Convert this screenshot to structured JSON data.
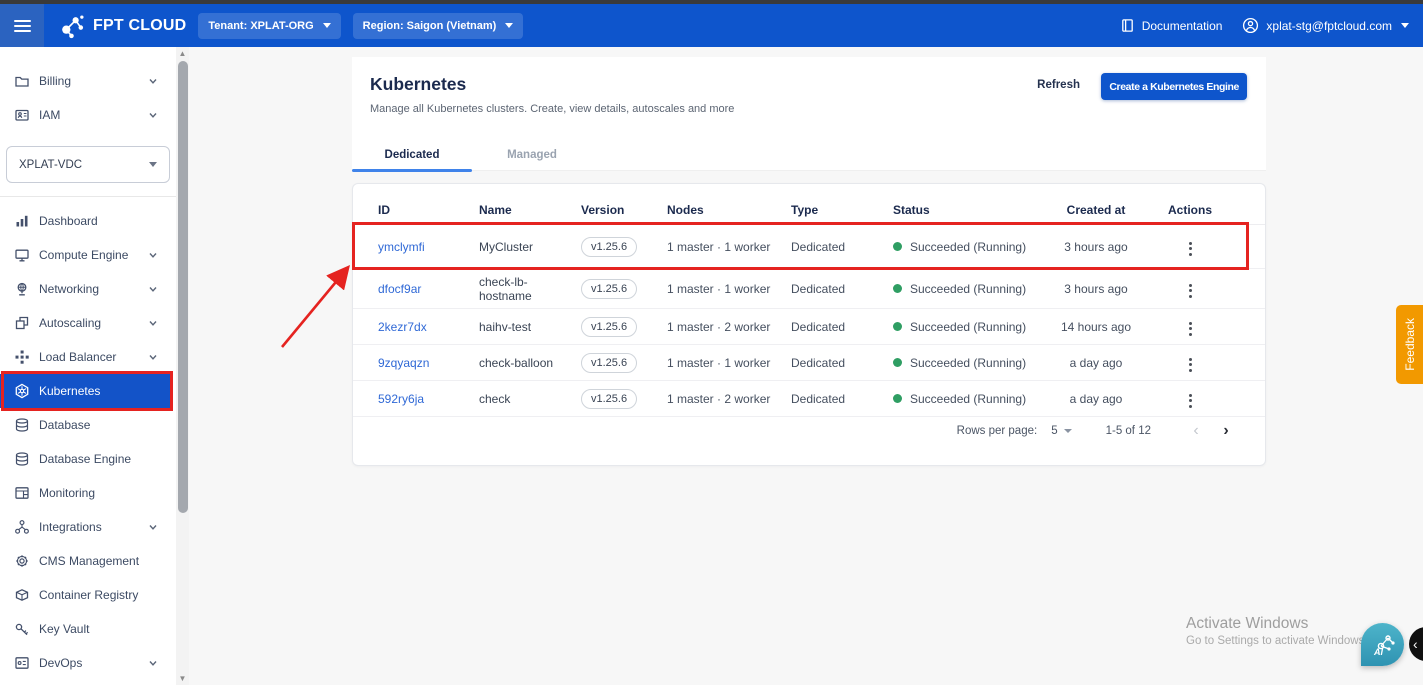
{
  "topbar": {
    "logo_text": "FPT CLOUD",
    "tenant": "Tenant: XPLAT-ORG",
    "region": "Region: Saigon (Vietnam)",
    "documentation": "Documentation",
    "account": "xplat-stg@fptcloud.com"
  },
  "sidebar": {
    "top_items": [
      {
        "label": "Billing",
        "icon": "billing",
        "chevron": true
      },
      {
        "label": "IAM",
        "icon": "iam",
        "chevron": true
      }
    ],
    "vdc_selector": "XPLAT-VDC",
    "items": [
      {
        "label": "Dashboard",
        "icon": "dashboard"
      },
      {
        "label": "Compute Engine",
        "icon": "compute-engine",
        "chevron": true
      },
      {
        "label": "Networking",
        "icon": "networking",
        "chevron": true
      },
      {
        "label": "Autoscaling",
        "icon": "autoscaling",
        "chevron": true
      },
      {
        "label": "Load Balancer",
        "icon": "load-balancer",
        "chevron": true
      },
      {
        "label": "Kubernetes",
        "icon": "kubernetes",
        "selected": true
      },
      {
        "label": "Database",
        "icon": "database"
      },
      {
        "label": "Database Engine",
        "icon": "database-engine"
      },
      {
        "label": "Monitoring",
        "icon": "monitoring"
      },
      {
        "label": "Integrations",
        "icon": "integrations",
        "chevron": true
      },
      {
        "label": "CMS Management",
        "icon": "cms-management"
      },
      {
        "label": "Container Registry",
        "icon": "container-registry"
      },
      {
        "label": "Key Vault",
        "icon": "key-vault"
      },
      {
        "label": "DevOps",
        "icon": "devops",
        "chevron": true
      }
    ]
  },
  "main": {
    "title": "Kubernetes",
    "subtitle": "Manage all Kubernetes clusters. Create, view details, autoscales and more",
    "refresh_label": "Refresh",
    "create_label": "Create a Kubernetes Engine",
    "tabs": {
      "active": "Dedicated",
      "inactive": "Managed"
    },
    "table": {
      "columns": [
        "ID",
        "Name",
        "Version",
        "Nodes",
        "Type",
        "Status",
        "Created at",
        "Actions"
      ],
      "rows": [
        {
          "id": "ymclymfi",
          "name": "MyCluster",
          "version": "v1.25.6",
          "nodes": "1 master · 1 worker",
          "type": "Dedicated",
          "status": "Succeeded (Running)",
          "created": "3 hours ago",
          "highlighted": true
        },
        {
          "id": "dfocf9ar",
          "name": "check-lb-hostname",
          "version": "v1.25.6",
          "nodes": "1 master · 1 worker",
          "type": "Dedicated",
          "status": "Succeeded (Running)",
          "created": "3 hours ago"
        },
        {
          "id": "2kezr7dx",
          "name": "haihv-test",
          "version": "v1.25.6",
          "nodes": "1 master · 2 worker",
          "type": "Dedicated",
          "status": "Succeeded (Running)",
          "created": "14 hours ago"
        },
        {
          "id": "9zqyaqzn",
          "name": "check-balloon",
          "version": "v1.25.6",
          "nodes": "1 master · 1 worker",
          "type": "Dedicated",
          "status": "Succeeded (Running)",
          "created": "a day ago"
        },
        {
          "id": "592ry6ja",
          "name": "check",
          "version": "v1.25.6",
          "nodes": "1 master · 2 worker",
          "type": "Dedicated",
          "status": "Succeeded (Running)",
          "created": "a day ago"
        }
      ],
      "pagination": {
        "rows_per_page_label": "Rows per page:",
        "rows_per_page": "5",
        "range": "1-5 of 12"
      }
    }
  },
  "feedback_label": "Feedback",
  "watermark": {
    "line1": "Activate Windows",
    "line2": "Go to Settings to activate Windows"
  },
  "ai_badge": "AI",
  "colors": {
    "topbar_blue": "#0e55cc",
    "selected_blue": "#1353c8",
    "link_blue": "#3069d6",
    "status_green": "#2f9e63",
    "annotation_red": "#e52320",
    "feedback_orange": "#f29900",
    "ai_teal": "#3fa9c2"
  }
}
